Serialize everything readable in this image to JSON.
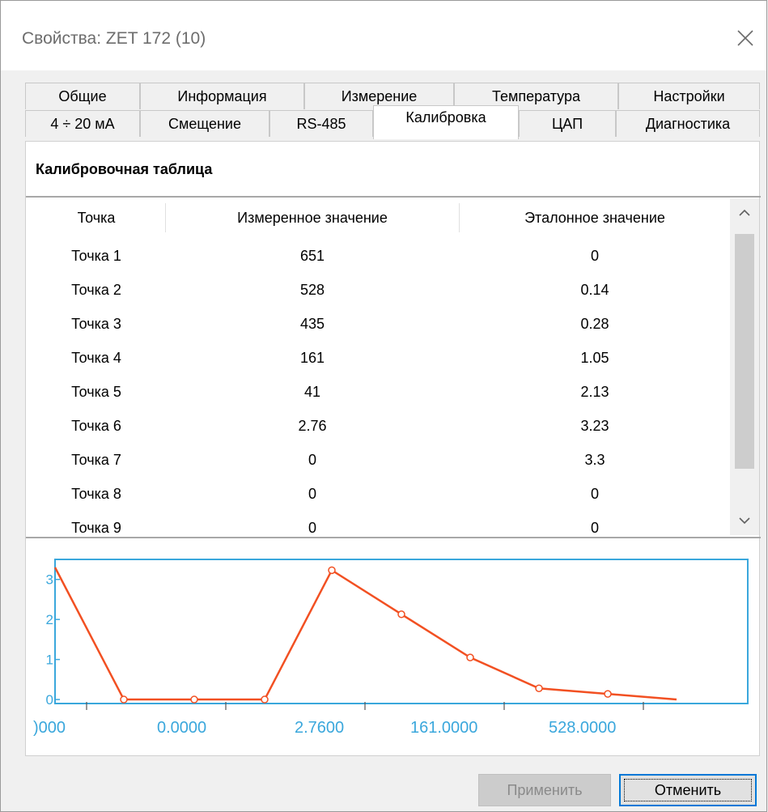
{
  "window": {
    "title": "Свойства: ZET 172 (10)"
  },
  "tabs": {
    "row1": [
      "Общие",
      "Информация",
      "Измерение",
      "Температура",
      "Настройки"
    ],
    "row2": [
      "4 ÷ 20 мА",
      "Смещение",
      "RS-485",
      "Калибровка",
      "ЦАП",
      "Диагностика"
    ],
    "active": "Калибровка"
  },
  "panel": {
    "title": "Калибровочная таблица"
  },
  "table": {
    "columns": [
      "Точка",
      "Измеренное значение",
      "Эталонное значение"
    ],
    "rows": [
      [
        "Точка 1",
        "651",
        "0"
      ],
      [
        "Точка 2",
        "528",
        "0.14"
      ],
      [
        "Точка 3",
        "435",
        "0.28"
      ],
      [
        "Точка 4",
        "161",
        "1.05"
      ],
      [
        "Точка 5",
        "41",
        "2.13"
      ],
      [
        "Точка 6",
        "2.76",
        "3.23"
      ],
      [
        "Точка 7",
        "0",
        "3.3"
      ],
      [
        "Точка 8",
        "0",
        "0"
      ],
      [
        "Точка 9",
        "0",
        "0"
      ]
    ]
  },
  "chart_data": {
    "type": "line",
    "xlabel": "",
    "ylabel": "",
    "x_tick_labels": [
      ")000",
      "0.0000",
      "2.7600",
      "161.0000",
      "528.0000"
    ],
    "y_tick_labels": [
      "3",
      "2",
      "1",
      "0"
    ],
    "ylim": [
      -0.1,
      3.5
    ],
    "series": [
      {
        "values": [
          3.3,
          0,
          0,
          0,
          3.23,
          2.13,
          1.05,
          0.28,
          0.14,
          0
        ]
      }
    ],
    "colors": {
      "line": "#f25022",
      "axis": "#3aa7dc"
    }
  },
  "buttons": {
    "apply": "Применить",
    "cancel": "Отменить"
  }
}
